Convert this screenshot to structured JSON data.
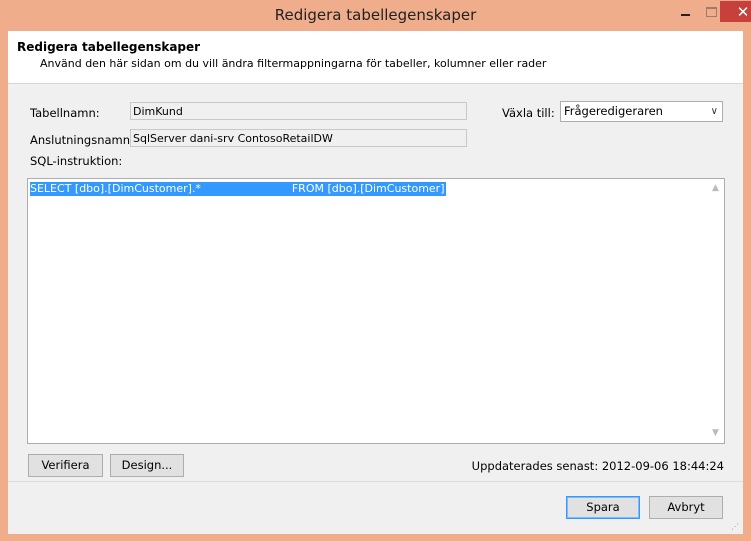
{
  "window": {
    "title": "Redigera tabellegenskaper",
    "close_glyph": "✕"
  },
  "header": {
    "title": "Redigera tabellegenskaper",
    "description": "Använd den här sidan om du vill ändra filtermappningarna för tabeller, kolumner eller rader"
  },
  "form": {
    "table_name_label": "Tabellnamn:",
    "table_name_value": "DimKund",
    "connection_label": "Anslutningsnamn:",
    "connection_value": "SqlServer dani-srv ContosoRetailDW",
    "switch_label": "Växla till:",
    "switch_value": "Frågeredigeraren",
    "sql_label": "SQL-instruktion:",
    "sql_text": "SELECT [dbo].[DimCustomer].*                          FROM [dbo].[DimCustomer]"
  },
  "actions": {
    "verify": "Verifiera",
    "design": "Design...",
    "updated": "Uppdaterades senast: 2012-09-06 18:44:24"
  },
  "footer": {
    "save": "Spara",
    "cancel": "Avbryt"
  },
  "icons": {
    "scroll_up": "▲",
    "scroll_down": "▼",
    "chevron": "∨",
    "grip": "⋰"
  }
}
